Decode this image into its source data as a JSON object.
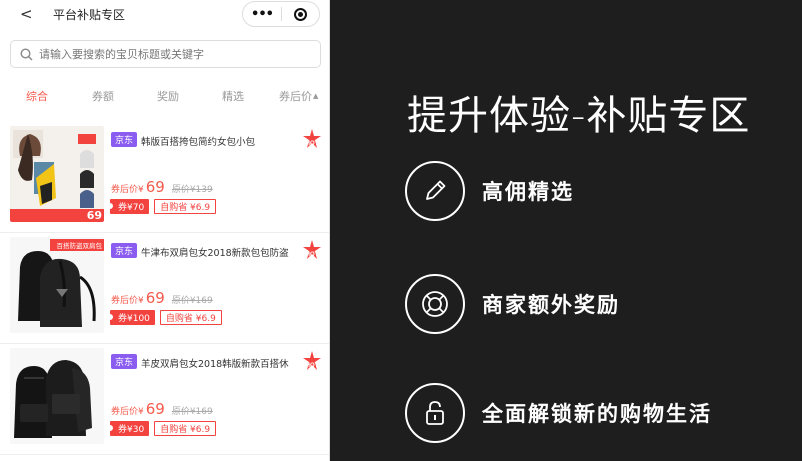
{
  "navbar": {
    "back_icon": "<",
    "title": "平台补贴专区",
    "more_icon": "•••"
  },
  "search": {
    "placeholder": "请输入要搜索的宝贝标题或关键字"
  },
  "tabs": [
    {
      "label": "综合",
      "active": true
    },
    {
      "label": "券额",
      "active": false
    },
    {
      "label": "奖励",
      "active": false
    },
    {
      "label": "精选",
      "active": false
    },
    {
      "label": "券后价",
      "active": false,
      "sort_icon": "▲"
    }
  ],
  "products": [
    {
      "platform": "京东",
      "title": "韩版百搭挎包简约女包小包",
      "price_label": "券后价¥",
      "price": "69",
      "original_price": "原价¥139",
      "coupon": "券¥70",
      "save": "自购省 ¥6.9",
      "thumb_sticker": "69"
    },
    {
      "platform": "京东",
      "title": "牛津布双肩包女2018新款包包防盗",
      "price_label": "券后价¥",
      "price": "69",
      "original_price": "原价¥169",
      "coupon": "券¥100",
      "save": "自购省 ¥6.9",
      "thumb_sticker": "百搭防盗双肩包"
    },
    {
      "platform": "京东",
      "title": "羊皮双肩包女2018韩版新款百搭休",
      "price_label": "券后价¥",
      "price": "69",
      "original_price": "原价¥169",
      "coupon": "券¥30",
      "save": "自购省 ¥6.9",
      "thumb_sticker": ""
    }
  ],
  "promo": {
    "headline": "提升体验-补贴专区",
    "features": [
      {
        "icon": "pencil-icon",
        "label": "高佣精选"
      },
      {
        "icon": "lifebuoy-icon",
        "label": "商家额外奖励"
      },
      {
        "icon": "lock-icon",
        "label": "全面解锁新的购物生活"
      }
    ]
  },
  "colors": {
    "accent": "#f45a4c",
    "badge": "#8a5cf0",
    "promo_bg": "#1e1e1e"
  }
}
